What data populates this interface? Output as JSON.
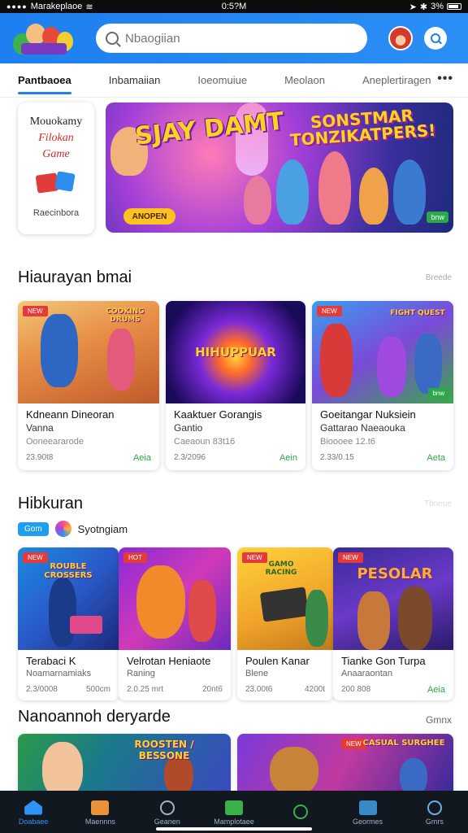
{
  "status_bar": {
    "carrier": "Marakeplaoe",
    "time": "0:5?M",
    "battery": "3%"
  },
  "app_bar": {
    "search_placeholder": "Nbaogiian"
  },
  "tabs": [
    {
      "label": "Pantbaoea",
      "active": true
    },
    {
      "label": "Inbamaiian",
      "active": false
    },
    {
      "label": "Ioeomuiue",
      "active": false
    },
    {
      "label": "Meolaon",
      "active": false
    },
    {
      "label": "Aneplertiragen",
      "active": false
    }
  ],
  "more_label": "•••",
  "promo": {
    "line1": "Mouokamy",
    "line2": "Filokan",
    "line3": "Game",
    "footer": "Raecinbora"
  },
  "hero": {
    "title": "SJAY DAMT",
    "subtitle": "SONSTMAR TONZIKATPERS!",
    "button": "ANOPEN",
    "badge": "bnw"
  },
  "sections": {
    "s1": {
      "title": "Hiaurayan bmai",
      "more": "Breede"
    },
    "s2": {
      "title": "Hibkuran",
      "more": "Tbneue",
      "chip": "Gom",
      "chip_label": "Syotngiam"
    },
    "s3": {
      "title": "Nanoannoh deryarde",
      "more": "Gmnx"
    }
  },
  "row1": [
    {
      "tag": "NEW",
      "thumb_title": "COOKING DRUMS",
      "name": "Kdneann Dineoran",
      "sub": "Vanna",
      "sub2": "Ooneeararode",
      "left": "23.90t8",
      "right": "Aeia",
      "badge": ""
    },
    {
      "tag": "",
      "thumb_title": "HIHUPPUAR",
      "name": "Kaaktuer Gorangis",
      "sub": "Gantio",
      "sub2": "Caeaoun 83t16",
      "left": "2.3/2096",
      "right": "Aein",
      "badge": ""
    },
    {
      "tag": "NEW",
      "thumb_title": "FIGHT QUEST",
      "name": "Goeitangar Nuksiein",
      "sub": "Gattarao Naeaouka",
      "sub2": "Bioooee 12.t6",
      "left": "2.33/0.15",
      "right": "Aeta",
      "badge": "bnw"
    }
  ],
  "row2": [
    {
      "tag": "NEW",
      "thumb_title": "ROUBLE CROSSERS",
      "name": "Terabaci K",
      "sub": "Noamarnamiaks",
      "left": "2.3/0008",
      "right": "500cm"
    },
    {
      "tag": "HOT",
      "thumb_title": "",
      "name": "Velrotan Heniaote",
      "sub": "Raning",
      "left": "2.0.25 mrt",
      "right": "20nt6"
    },
    {
      "tag": "NEW",
      "thumb_title": "GAMO RACING",
      "name": "Poulen Kanar",
      "sub": "Blene",
      "left": "23.00t6",
      "right": "4200t"
    },
    {
      "tag": "NEW",
      "thumb_title": "PESOLAR",
      "name": "Tianke Gon Turpa",
      "sub": "Anaaraontan",
      "left": "200 808",
      "right": "Aeia"
    }
  ],
  "row3": [
    {
      "tag": "",
      "thumb_title": "ROOSTEN / BESSONE"
    },
    {
      "tag": "NEW",
      "thumb_title": "CASUAL SURGHEE"
    }
  ],
  "bottom_nav": [
    {
      "label": "Doabaee",
      "active": true
    },
    {
      "label": "Maennns",
      "active": false
    },
    {
      "label": "Geanen",
      "active": false
    },
    {
      "label": "Mamplotaee",
      "active": false
    },
    {
      "label": "",
      "active": false
    },
    {
      "label": "Geormes",
      "active": false
    },
    {
      "label": "Gmrs",
      "active": false
    }
  ],
  "colors": {
    "accent": "#1e7ff0",
    "appbar": "#2a8ff5",
    "nav_bg": "#111820",
    "price_green": "#2aa84a"
  }
}
